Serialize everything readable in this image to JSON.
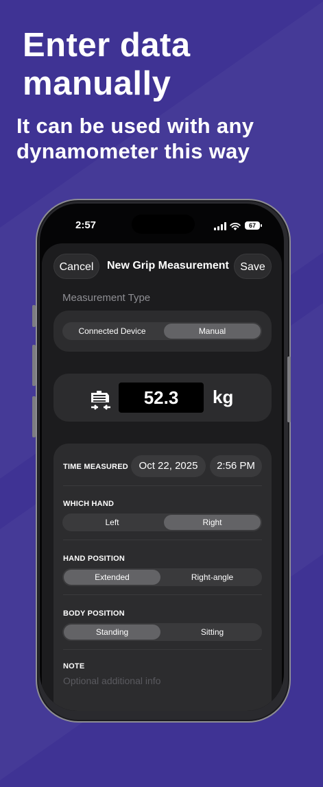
{
  "promo": {
    "headline_line1": "Enter data",
    "headline_line2": "manually",
    "sub_line1": "It can be used with any",
    "sub_line2": "dynamometer this way"
  },
  "status_bar": {
    "time": "2:57",
    "battery": "67"
  },
  "nav": {
    "cancel": "Cancel",
    "title": "New Grip Measurement",
    "save": "Save"
  },
  "measurement_type": {
    "label": "Measurement Type",
    "options": [
      "Connected Device",
      "Manual"
    ],
    "selected": "Manual"
  },
  "reading": {
    "value": "52.3",
    "unit": "kg",
    "icon": "grip-fist-icon"
  },
  "form": {
    "time_measured": {
      "label": "TIME MEASURED",
      "date": "Oct 22, 2025",
      "time": "2:56 PM"
    },
    "which_hand": {
      "label": "WHICH HAND",
      "options": [
        "Left",
        "Right"
      ],
      "selected": "Right"
    },
    "hand_position": {
      "label": "HAND POSITION",
      "options": [
        "Extended",
        "Right-angle"
      ],
      "selected": "Extended"
    },
    "body_position": {
      "label": "BODY POSITION",
      "options": [
        "Standing",
        "Sitting"
      ],
      "selected": "Standing"
    },
    "note": {
      "label": "NOTE",
      "placeholder": "Optional additional info"
    }
  },
  "colors": {
    "background": "#3f3394",
    "sheet": "#1c1c1e",
    "card": "#2c2c2e",
    "selected_segment": "#636366"
  }
}
